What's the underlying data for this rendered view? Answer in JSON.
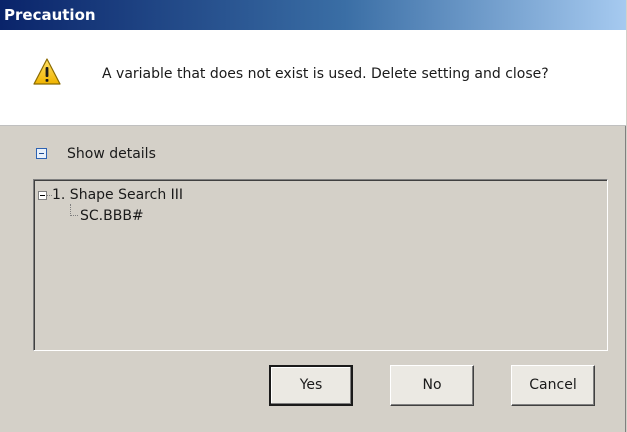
{
  "dialog": {
    "title": "Precaution",
    "icon": "warning-icon",
    "message": "A variable that does not exist is used. Delete setting and close?"
  },
  "details": {
    "toggle_label": "Show details",
    "expanded": true,
    "tree": {
      "root_label": "1. Shape Search III",
      "children": [
        "SC.BBB#"
      ]
    }
  },
  "buttons": {
    "yes": "Yes",
    "no": "No",
    "cancel": "Cancel"
  },
  "colors": {
    "titlebar_start": "#0a246a",
    "titlebar_end": "#a6caf0",
    "dialog_bg": "#d4d0c8",
    "message_bg": "#ffffff",
    "warning_yellow": "#f5c400"
  }
}
